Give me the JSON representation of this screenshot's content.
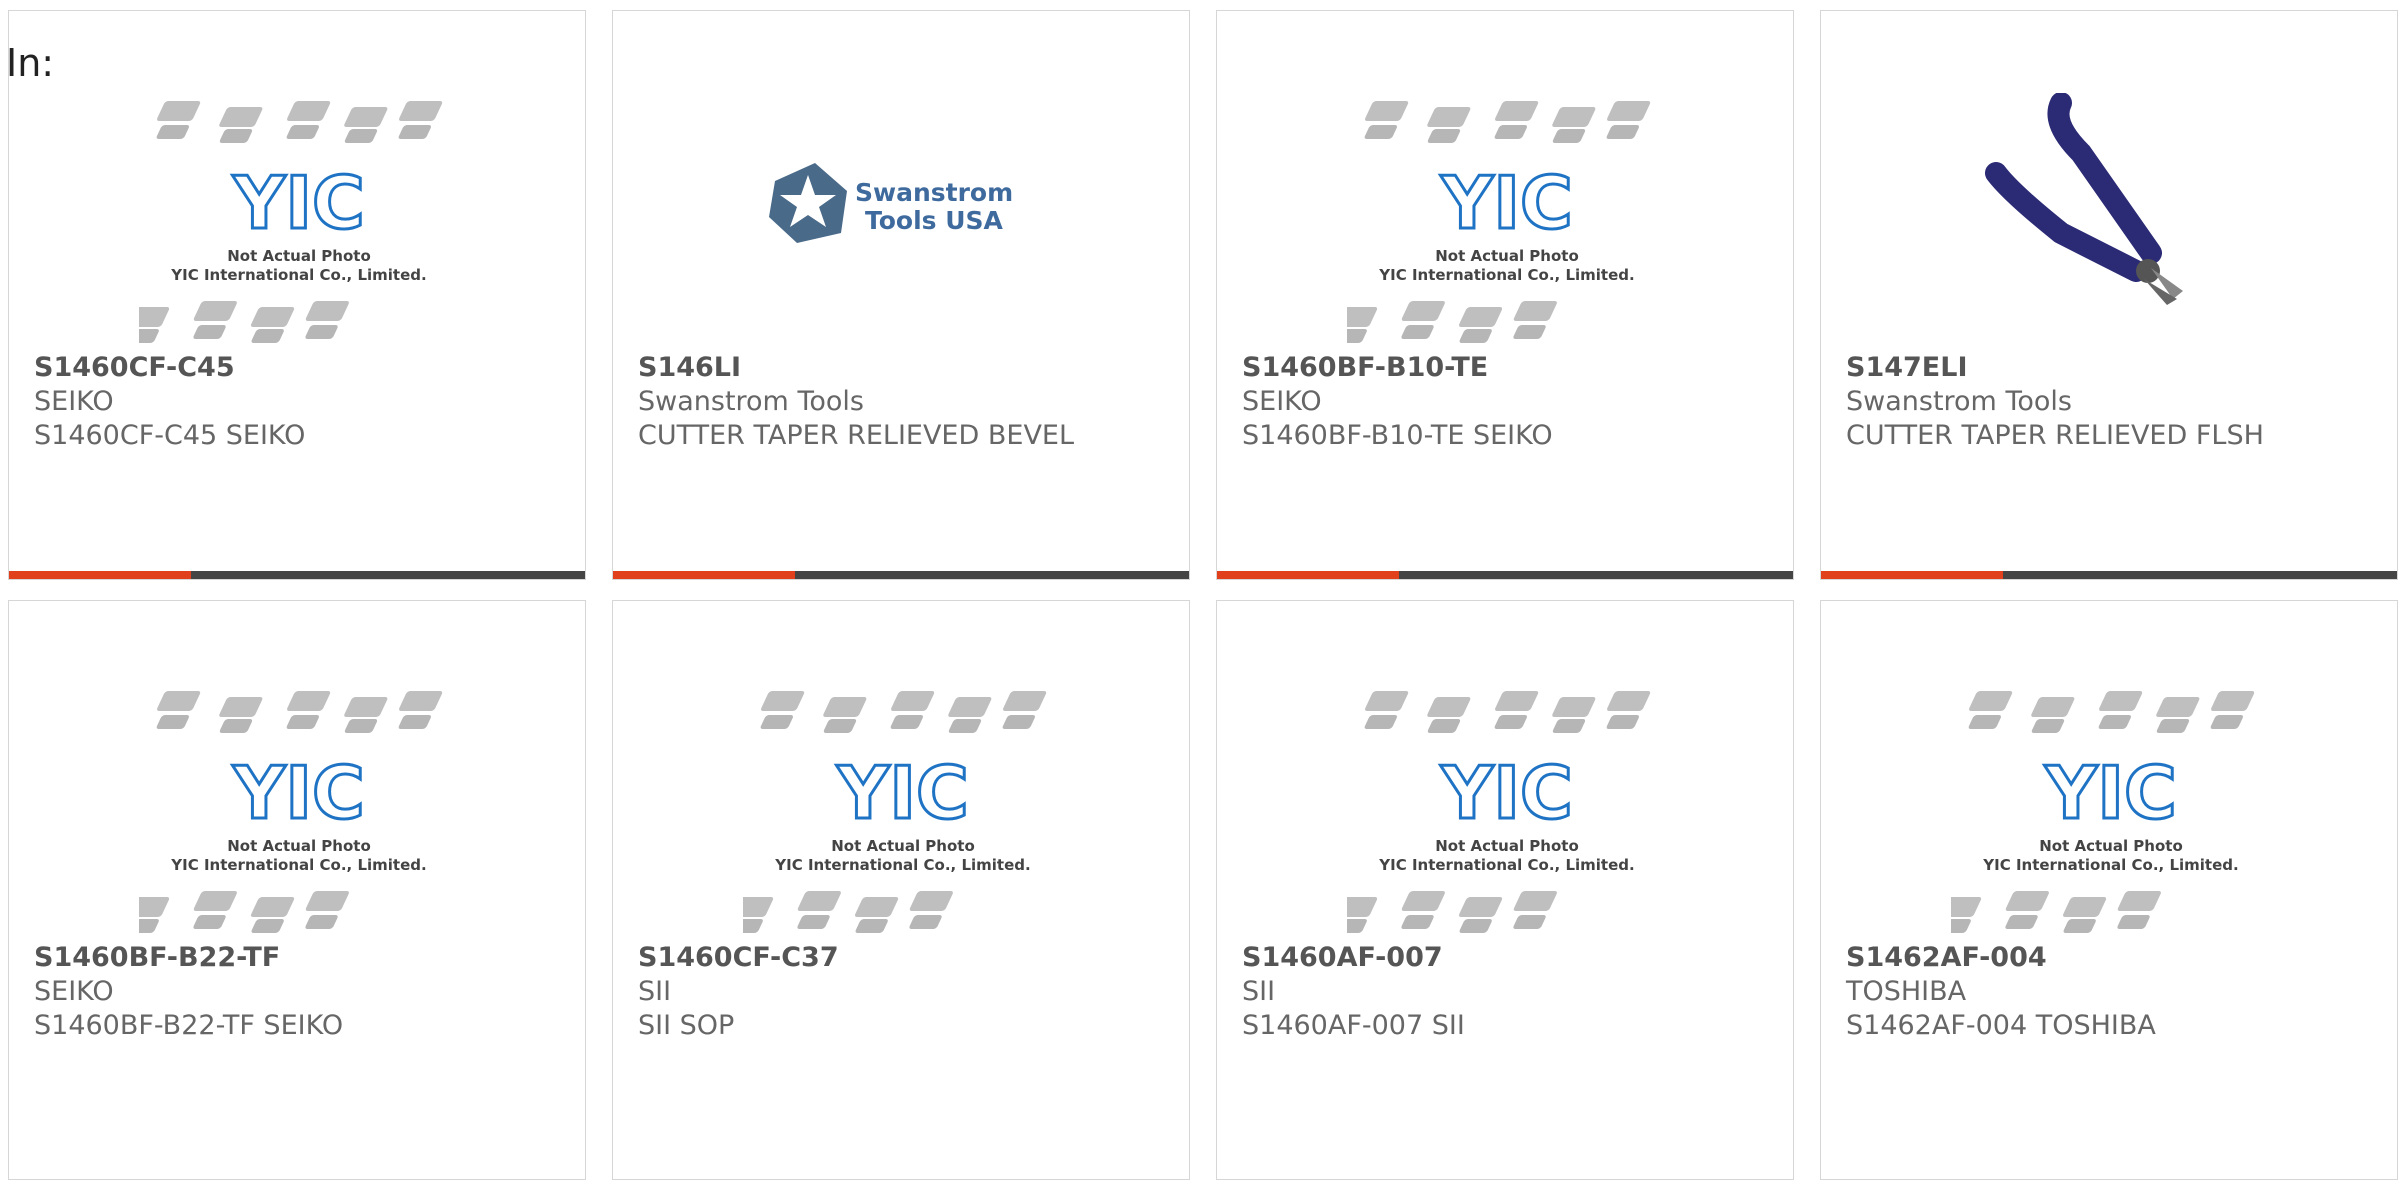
{
  "in_label": "In:",
  "placeholder_logo": {
    "brand": "YIC",
    "caption1": "Not Actual Photo",
    "caption2": "YIC International Co., Limited."
  },
  "swanstrom_logo": {
    "line1": "Swanstrom",
    "line2": "Tools USA"
  },
  "colors": {
    "accent": "#e0401c",
    "bar": "#444444",
    "yic_blue": "#1f73c4",
    "plier_handle": "#2b2a75"
  },
  "products": [
    {
      "part_number": "S1460CF-C45",
      "manufacturer": "SEIKO",
      "description": "S1460CF-C45 SEIKO",
      "image": "yic-placeholder"
    },
    {
      "part_number": "S146LI",
      "manufacturer": "Swanstrom Tools",
      "description": "CUTTER TAPER RELIEVED BEVEL",
      "image": "swanstrom-logo"
    },
    {
      "part_number": "S1460BF-B10-TE",
      "manufacturer": "SEIKO",
      "description": "S1460BF-B10-TE SEIKO",
      "image": "yic-placeholder"
    },
    {
      "part_number": "S147ELI",
      "manufacturer": "Swanstrom Tools",
      "description": "CUTTER TAPER RELIEVED FLSH",
      "image": "cutter-photo"
    },
    {
      "part_number": "S1460BF-B22-TF",
      "manufacturer": "SEIKO",
      "description": "S1460BF-B22-TF SEIKO",
      "image": "yic-placeholder"
    },
    {
      "part_number": "S1460CF-C37",
      "manufacturer": "SII",
      "description": "SII SOP",
      "image": "yic-placeholder"
    },
    {
      "part_number": "S1460AF-007",
      "manufacturer": "SII",
      "description": "S1460AF-007 SII",
      "image": "yic-placeholder"
    },
    {
      "part_number": "S1462AF-004",
      "manufacturer": "TOSHIBA",
      "description": "S1462AF-004 TOSHIBA",
      "image": "yic-placeholder"
    }
  ]
}
